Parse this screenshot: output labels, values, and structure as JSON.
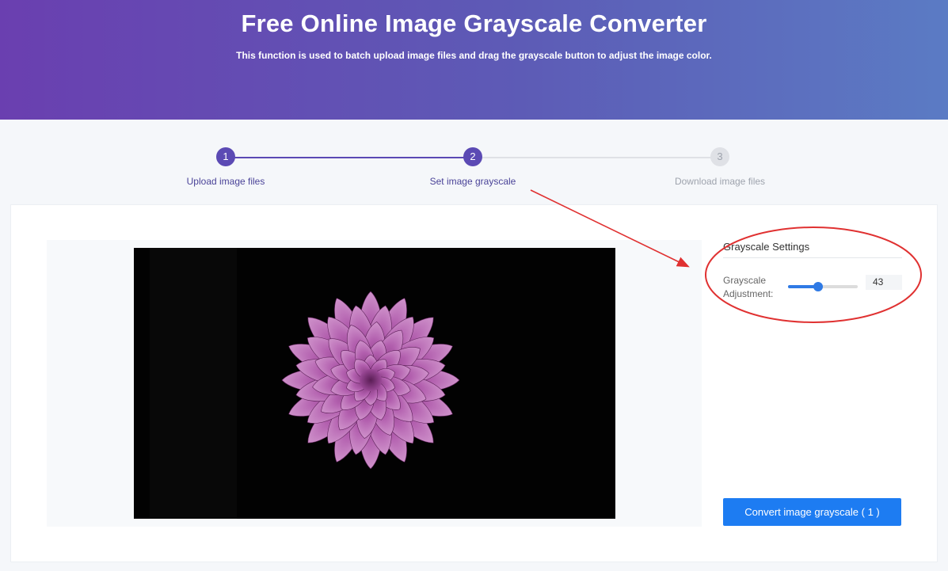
{
  "hero": {
    "title": "Free Online Image Grayscale Converter",
    "subtitle": "This function is used to batch upload image files and drag the grayscale button to adjust the image color."
  },
  "steps": [
    {
      "number": "1",
      "label": "Upload image files",
      "state": "done"
    },
    {
      "number": "2",
      "label": "Set image grayscale",
      "state": "done"
    },
    {
      "number": "3",
      "label": "Download image files",
      "state": "todo"
    }
  ],
  "settings": {
    "title": "Grayscale Settings",
    "adjustment_label": "Grayscale Adjustment:",
    "value": "43",
    "value_fraction": 0.43
  },
  "convert_button": "Convert image grayscale ( 1 )",
  "colors": {
    "accent": "#5b4ab4",
    "button": "#1d7cf2",
    "annotation": "#e03131"
  }
}
